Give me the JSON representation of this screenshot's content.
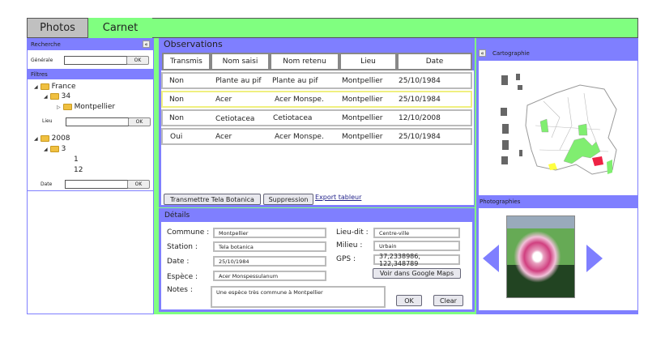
{
  "tabs": [
    {
      "label": "Photos"
    },
    {
      "label": "Carnet"
    }
  ],
  "sidebar": {
    "search_title": "Recherche",
    "collapse_icon": "«",
    "general_label": "Générale",
    "ok": "OK",
    "filters_title": "Filtres",
    "tree": [
      {
        "label": "France"
      },
      {
        "label": "34"
      },
      {
        "label": "Montpellier"
      }
    ],
    "lieu_label": "Lieu",
    "date_tree": [
      {
        "label": "2008"
      },
      {
        "label": "3"
      },
      {
        "label": "1"
      },
      {
        "label": "12"
      }
    ],
    "date_label": "Date"
  },
  "observations": {
    "title": "Observations",
    "columns": [
      "Transmis",
      "Nom saisi",
      "Nom retenu",
      "Lieu",
      "Date"
    ],
    "rows": [
      [
        "Non",
        "Plante au pif",
        "Plante au pif",
        "Montpellier",
        "25/10/1984"
      ],
      [
        "Non",
        "Acer",
        "Acer Monspe.",
        "Montpellier",
        "25/10/1984"
      ],
      [
        "Non",
        "Cetiotacea",
        "Cetiotacea",
        "Montpellier",
        "12/10/2008"
      ],
      [
        "Oui",
        "Acer",
        "Acer Monspe.",
        "Montpellier",
        "25/10/1984"
      ]
    ],
    "selected_row": 1,
    "transmit_button": "Transmettre Tela Botanica",
    "delete_button": "Suppression",
    "export_link": "Export tableur"
  },
  "details": {
    "title": "Détails",
    "commune_label": "Commune :",
    "commune": "Montpellier",
    "station_label": "Station :",
    "station": "Tela botanica",
    "date_label": "Date :",
    "date": "25/10/1984",
    "espece_label": "Espèce :",
    "espece": "Acer Monspessulanum",
    "notes_label": "Notes :",
    "notes": "Une espèce très commune à Montpellier",
    "lieudit_label": "Lieu-dit :",
    "lieudit": "Centre-ville",
    "milieu_label": "Milieu :",
    "milieu": "Urbain",
    "gps_label": "GPS :",
    "gps": "37,2338986, 122,348789",
    "maps_button": "Voir dans Google Maps",
    "ok_button": "OK",
    "clear_button": "Clear"
  },
  "right": {
    "carto_title": "Cartographie",
    "collapse_icon": "«",
    "photos_title": "Photographies"
  },
  "colors": {
    "accent": "#7f7fff",
    "green": "#80ff80",
    "tab_gray": "#c0c0c0"
  }
}
